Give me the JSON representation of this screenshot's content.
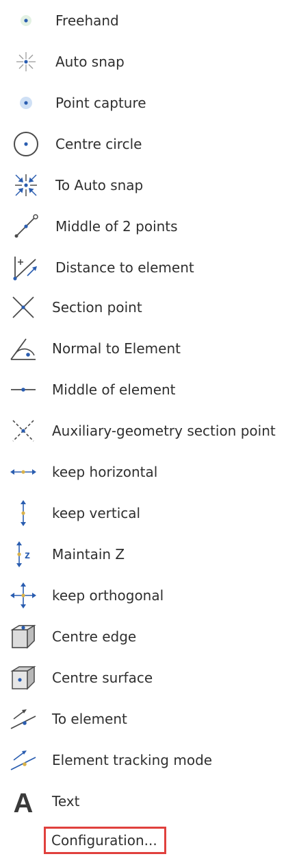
{
  "menu": {
    "items": [
      {
        "label": "Freehand",
        "icon": "freehand-icon"
      },
      {
        "label": "Auto snap",
        "icon": "auto-snap-icon"
      },
      {
        "label": "Point capture",
        "icon": "point-capture-icon"
      },
      {
        "label": "Centre circle",
        "icon": "centre-circle-icon"
      },
      {
        "label": "To Auto snap",
        "icon": "to-auto-snap-icon"
      },
      {
        "label": "Middle of 2 points",
        "icon": "middle-two-points-icon"
      },
      {
        "label": "Distance to element",
        "icon": "distance-to-element-icon"
      },
      {
        "label": "Section point",
        "icon": "section-point-icon"
      },
      {
        "label": "Normal to Element",
        "icon": "normal-to-element-icon"
      },
      {
        "label": "Middle of element",
        "icon": "middle-of-element-icon"
      },
      {
        "label": "Auxiliary-geometry section point",
        "icon": "auxiliary-section-point-icon"
      },
      {
        "label": "keep horizontal",
        "icon": "keep-horizontal-icon"
      },
      {
        "label": "keep vertical",
        "icon": "keep-vertical-icon"
      },
      {
        "label": "Maintain Z",
        "icon": "maintain-z-icon"
      },
      {
        "label": "keep orthogonal",
        "icon": "keep-orthogonal-icon"
      },
      {
        "label": "Centre edge",
        "icon": "centre-edge-icon"
      },
      {
        "label": "Centre surface",
        "icon": "centre-surface-icon"
      },
      {
        "label": "To element",
        "icon": "to-element-icon"
      },
      {
        "label": "Element tracking mode",
        "icon": "element-tracking-icon"
      },
      {
        "label": "Text",
        "icon": "text-icon",
        "icon_glyph": "A"
      }
    ],
    "configuration_label": "Configuration...",
    "colors": {
      "accent_blue": "#2a5db0",
      "icon_gray": "#555555",
      "highlight_border": "#e0403d",
      "marker_yellow": "#d9b24a"
    }
  }
}
